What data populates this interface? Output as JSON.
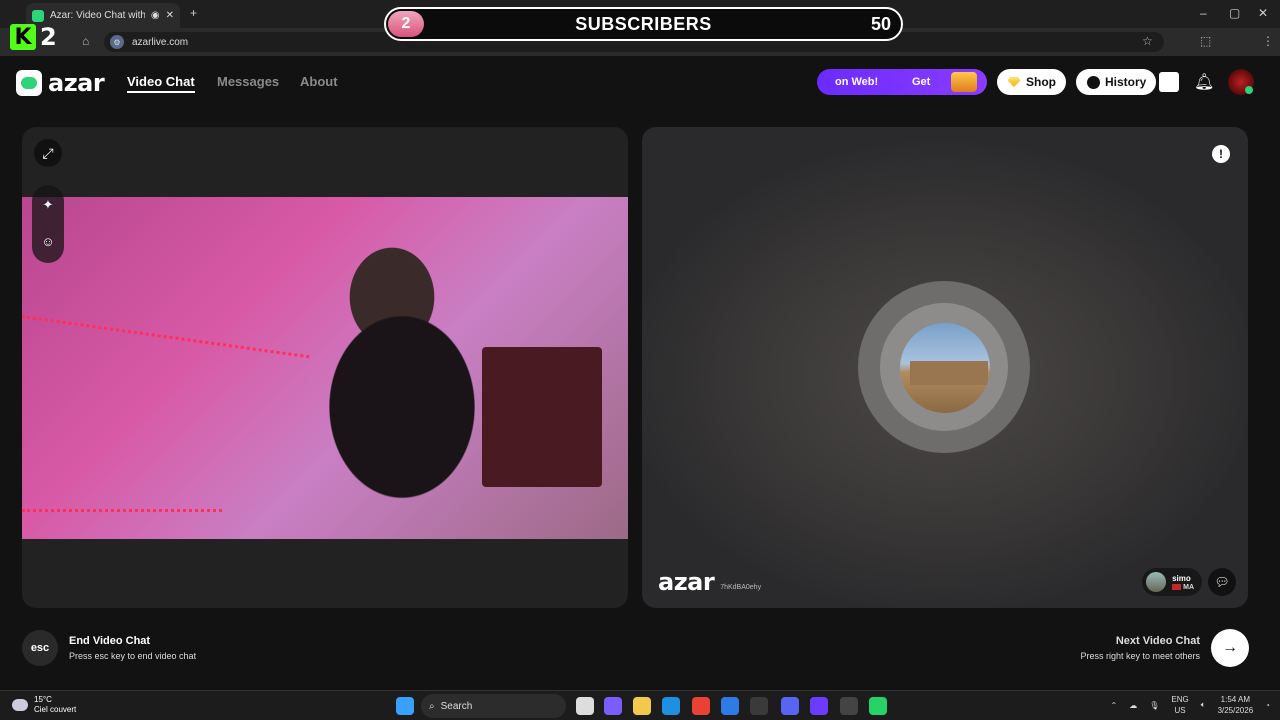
{
  "browser": {
    "tab_title": "Azar: Video Chat with New",
    "url": "azarlive.com"
  },
  "overlay": {
    "logo_letter": "K",
    "logo_number": "2",
    "subscriber_count": "2",
    "subscriber_label": "SUBSCRIBERS",
    "subscriber_goal": "50",
    "progress_fraction": 0.04
  },
  "header": {
    "brand": "azar",
    "nav": [
      {
        "label": "Video Chat",
        "active": true
      },
      {
        "label": "Messages",
        "active": false
      },
      {
        "label": "About",
        "active": false
      }
    ],
    "promo_text_1": "on Web!",
    "promo_text_2": "Get",
    "shop_label": "Shop",
    "history_label": "History"
  },
  "right_panel": {
    "watermark": "azar",
    "watermark_id": "7hKdBA0ehy",
    "peer_name": "simo",
    "peer_country": "MA"
  },
  "footer": {
    "esc_label": "esc",
    "end_title": "End Video Chat",
    "end_sub": "Press esc key to end video chat",
    "next_title": "Next Video Chat",
    "next_sub": "Press right key to meet others"
  },
  "taskbar": {
    "temp": "15°C",
    "weather": "Ciel couvert",
    "search_label": "Search",
    "lang_1": "ENG",
    "lang_2": "US",
    "time": "1:54 AM",
    "date": "3/25/2026"
  },
  "colors": {
    "accent_green": "#2ed47a",
    "promo_purple": "#7a33ff",
    "kick_green": "#53fc18"
  }
}
